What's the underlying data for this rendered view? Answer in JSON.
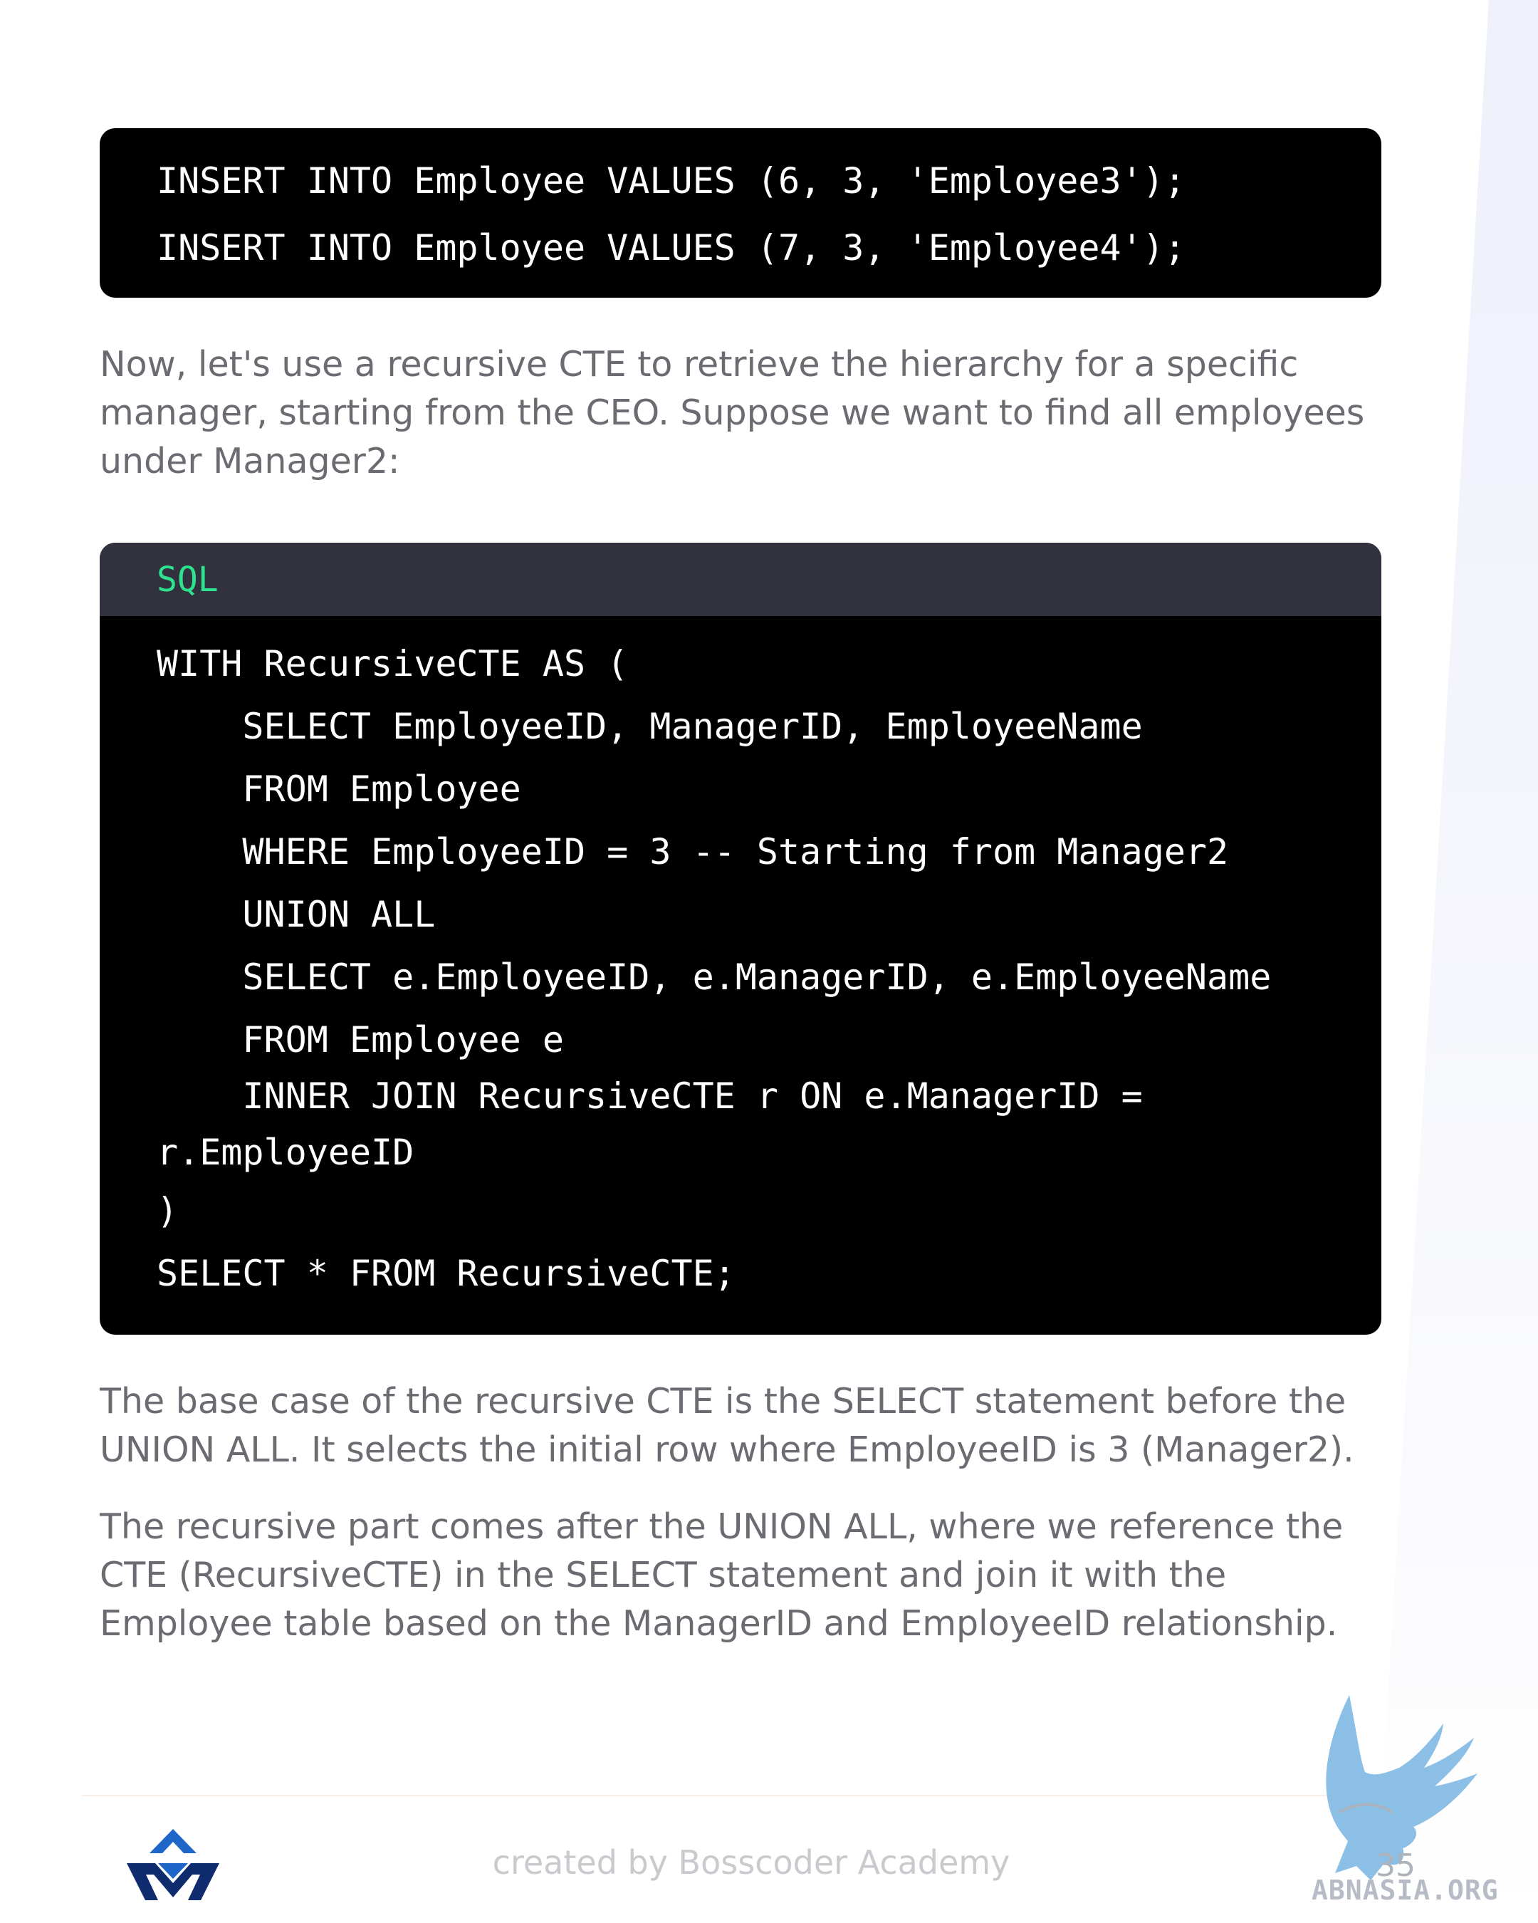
{
  "code_top": {
    "lines": [
      "INSERT INTO Employee VALUES (6, 3, 'Employee3');",
      "INSERT INTO Employee VALUES (7, 3, 'Employee4');"
    ]
  },
  "intro_paragraph": "Now, let's use a recursive CTE to retrieve the hierarchy for a specific manager, starting from the CEO. Suppose we want to find all employees under Manager2:",
  "code_main": {
    "language": "SQL",
    "lines": [
      "WITH RecursiveCTE AS (",
      "    SELECT EmployeeID, ManagerID, EmployeeName",
      "    FROM Employee",
      "    WHERE EmployeeID = 3 -- Starting from Manager2",
      "    UNION ALL",
      "    SELECT e.EmployeeID, e.ManagerID, e.EmployeeName",
      "    FROM Employee e",
      "    INNER JOIN RecursiveCTE r ON e.ManagerID =",
      "r.EmployeeID",
      ")",
      "SELECT * FROM RecursiveCTE;"
    ]
  },
  "paragraph_base_case": "The base case of the recursive CTE is the SELECT statement before the UNION ALL. It selects the initial row where EmployeeID is 3 (Manager2).",
  "paragraph_recursive_part": "The recursive part comes after the UNION ALL, where we reference the CTE (RecursiveCTE) in the SELECT statement and join it with the Employee table based on the ManagerID and EmployeeID relationship.",
  "footer": {
    "credit": "created by Bosscoder Academy",
    "page_number": "35",
    "watermark": "ABNASIA.ORG",
    "logo_icon": "bosscoder-logo-icon",
    "watermark_icon": "eagle-icon"
  },
  "colors": {
    "code_background": "#000000",
    "code_header": "#31323d",
    "language_label": "#2de38f",
    "body_text": "#6b6b72",
    "logo_blue": "#1f66c9",
    "logo_navy": "#0f2c6e",
    "eagle_blue": "#7fb8e3"
  }
}
